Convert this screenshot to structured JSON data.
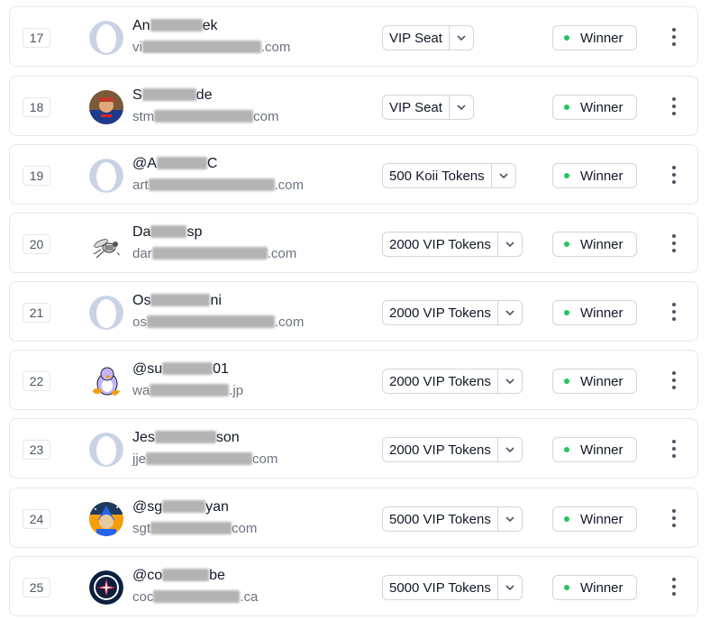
{
  "colors": {
    "status_dot": "#22c55e",
    "row_border": "#e5e7eb",
    "placeholder_avatar": "#c9d3e5"
  },
  "rows": [
    {
      "rank": "17",
      "name_start": "An",
      "name_end": "ek",
      "email_start": "vi",
      "email_end": ".com",
      "prize": "VIP Seat",
      "status": "Winner",
      "avatar": "placeholder-avatar-icon"
    },
    {
      "rank": "18",
      "name_start": "S",
      "name_end": "de",
      "email_start": "stm",
      "email_end": "com",
      "prize": "VIP Seat",
      "status": "Winner",
      "avatar": "user-photo-avatar"
    },
    {
      "rank": "19",
      "name_start": "@A",
      "name_end": "C",
      "email_start": "art",
      "email_end": ".com",
      "prize": "500 Koii Tokens",
      "status": "Winner",
      "avatar": "placeholder-avatar-icon"
    },
    {
      "rank": "20",
      "name_start": "Da",
      "name_end": "sp",
      "email_start": "dar",
      "email_end": ".com",
      "prize": "2000 VIP Tokens",
      "status": "Winner",
      "avatar": "wasp-avatar-icon"
    },
    {
      "rank": "21",
      "name_start": "Os",
      "name_end": "ni",
      "email_start": "os",
      "email_end": ".com",
      "prize": "2000 VIP Tokens",
      "status": "Winner",
      "avatar": "placeholder-avatar-icon"
    },
    {
      "rank": "22",
      "name_start": "@su",
      "name_end": "01",
      "email_start": "wa",
      "email_end": ".jp",
      "prize": "2000 VIP Tokens",
      "status": "Winner",
      "avatar": "penguin-avatar-icon"
    },
    {
      "rank": "23",
      "name_start": "Jes",
      "name_end": "son",
      "email_start": "jje",
      "email_end": "com",
      "prize": "2000 VIP Tokens",
      "status": "Winner",
      "avatar": "placeholder-avatar-icon"
    },
    {
      "rank": "24",
      "name_start": "@sg",
      "name_end": "yan",
      "email_start": "sgt",
      "email_end": "com",
      "prize": "5000 VIP Tokens",
      "status": "Winner",
      "avatar": "cartoon-avatar-icon"
    },
    {
      "rank": "25",
      "name_start": "@co",
      "name_end": "be",
      "email_start": "coc",
      "email_end": ".ca",
      "prize": "5000 VIP Tokens",
      "status": "Winner",
      "avatar": "jets-logo-avatar-icon"
    }
  ]
}
